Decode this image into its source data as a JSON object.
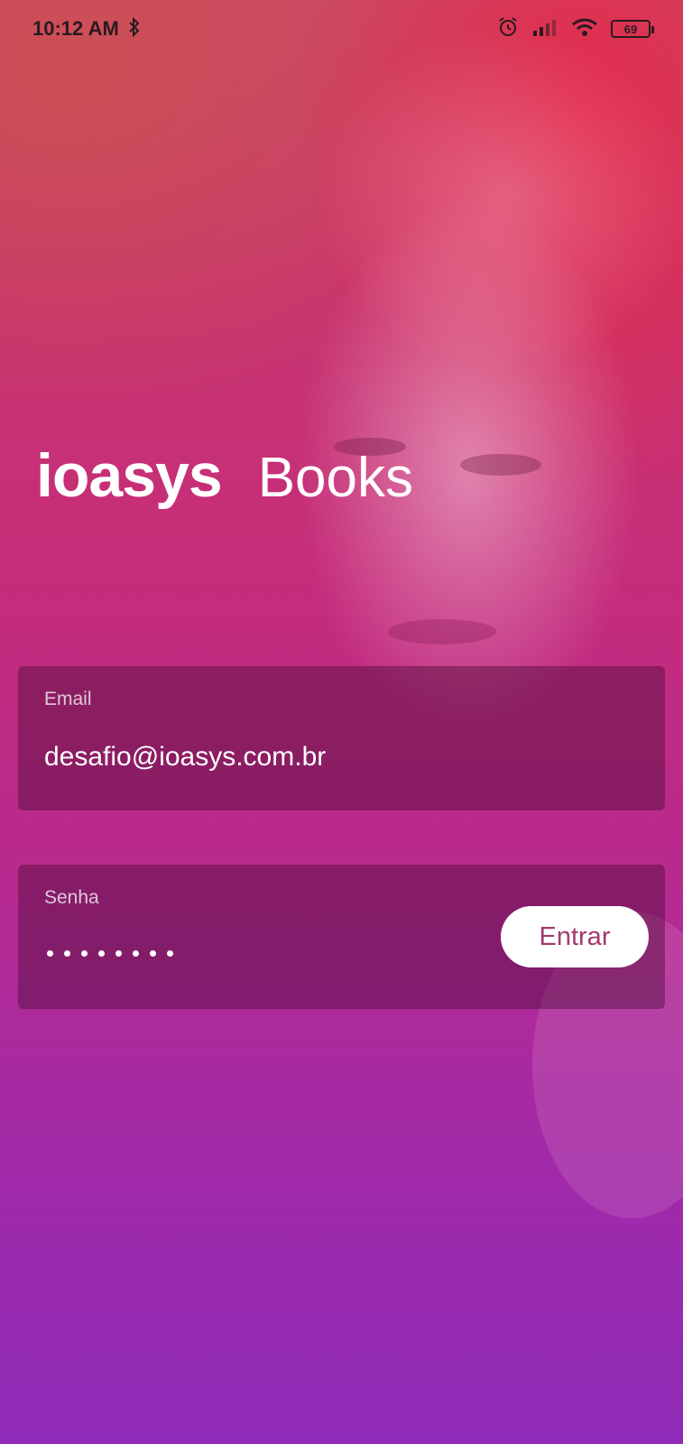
{
  "status_bar": {
    "time": "10:12 AM",
    "battery": "69",
    "icons": [
      "bluetooth-icon",
      "alarm-icon",
      "signal-icon",
      "wifi-icon",
      "battery-icon"
    ]
  },
  "logo": {
    "brand": "ioasys",
    "product": "Books"
  },
  "login_form": {
    "email_label": "Email",
    "email_value": "desafio@ioasys.com.br",
    "password_label": "Senha",
    "password_dot_count": 8,
    "submit_label": "Entrar"
  },
  "colors": {
    "field_background": "#461032",
    "button_text": "#a33a6f",
    "button_background": "#ffffff"
  }
}
